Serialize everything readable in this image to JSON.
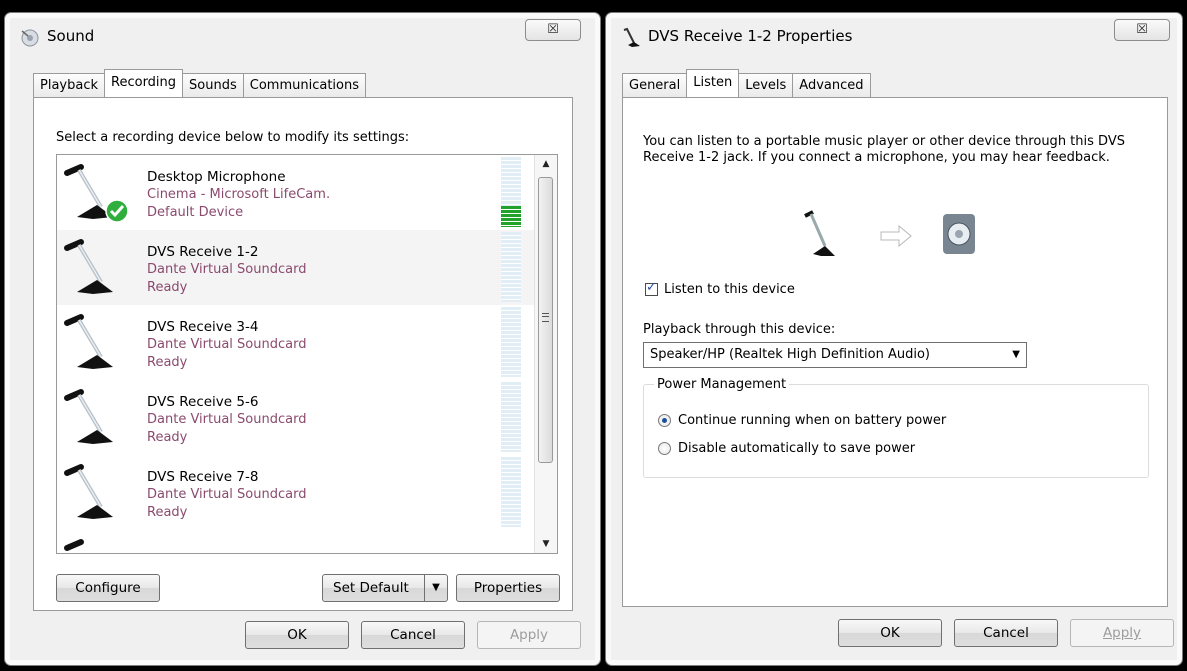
{
  "sound_window": {
    "title": "Sound",
    "close_label": "☒",
    "tabs": [
      {
        "label": "Playback"
      },
      {
        "label": "Recording"
      },
      {
        "label": "Sounds"
      },
      {
        "label": "Communications"
      }
    ],
    "active_tab": "Recording",
    "instructions": "Select a recording device below to modify its settings:",
    "devices": [
      {
        "name": "Desktop Microphone",
        "driver": "Cinema - Microsoft LifeCam.",
        "status": "Default Device",
        "is_default": true,
        "level": 0.3,
        "icon": "microphone-icon"
      },
      {
        "name": "DVS Receive 1-2",
        "driver": "Dante Virtual Soundcard",
        "status": "Ready",
        "is_default": false,
        "level": 0,
        "icon": "microphone-icon"
      },
      {
        "name": "DVS Receive 3-4",
        "driver": "Dante Virtual Soundcard",
        "status": "Ready",
        "is_default": false,
        "level": 0,
        "icon": "microphone-icon"
      },
      {
        "name": "DVS Receive 5-6",
        "driver": "Dante Virtual Soundcard",
        "status": "Ready",
        "is_default": false,
        "level": 0,
        "icon": "microphone-icon"
      },
      {
        "name": "DVS Receive 7-8",
        "driver": "Dante Virtual Soundcard",
        "status": "Ready",
        "is_default": false,
        "level": 0,
        "icon": "microphone-icon"
      }
    ],
    "buttons": {
      "configure": "Configure",
      "set_default": "Set Default",
      "properties": "Properties",
      "ok": "OK",
      "cancel": "Cancel",
      "apply": "Apply"
    }
  },
  "props_window": {
    "title": "DVS Receive 1-2 Properties",
    "close_label": "☒",
    "tabs": [
      {
        "label": "General"
      },
      {
        "label": "Listen"
      },
      {
        "label": "Levels"
      },
      {
        "label": "Advanced"
      }
    ],
    "active_tab": "Listen",
    "description": "You can listen to a portable music player or other device through this DVS Receive 1-2 jack.  If you connect a microphone, you may hear feedback.",
    "listen_checkbox": {
      "label": "Listen to this device",
      "checked": true
    },
    "playback_label": "Playback through this device:",
    "playback_device": "Speaker/HP (Realtek High Definition Audio)",
    "power_group": {
      "title": "Power Management",
      "options": [
        {
          "label": "Continue running when on battery power",
          "selected": true
        },
        {
          "label": "Disable automatically to save power",
          "selected": false
        }
      ]
    },
    "buttons": {
      "ok": "OK",
      "cancel": "Cancel",
      "apply": "Apply"
    }
  },
  "colors": {
    "status_text": "#8a4a6e",
    "meter_active": "#1fa32a",
    "meter_idle": "#e2eef6",
    "default_check": "#2fae3d"
  }
}
